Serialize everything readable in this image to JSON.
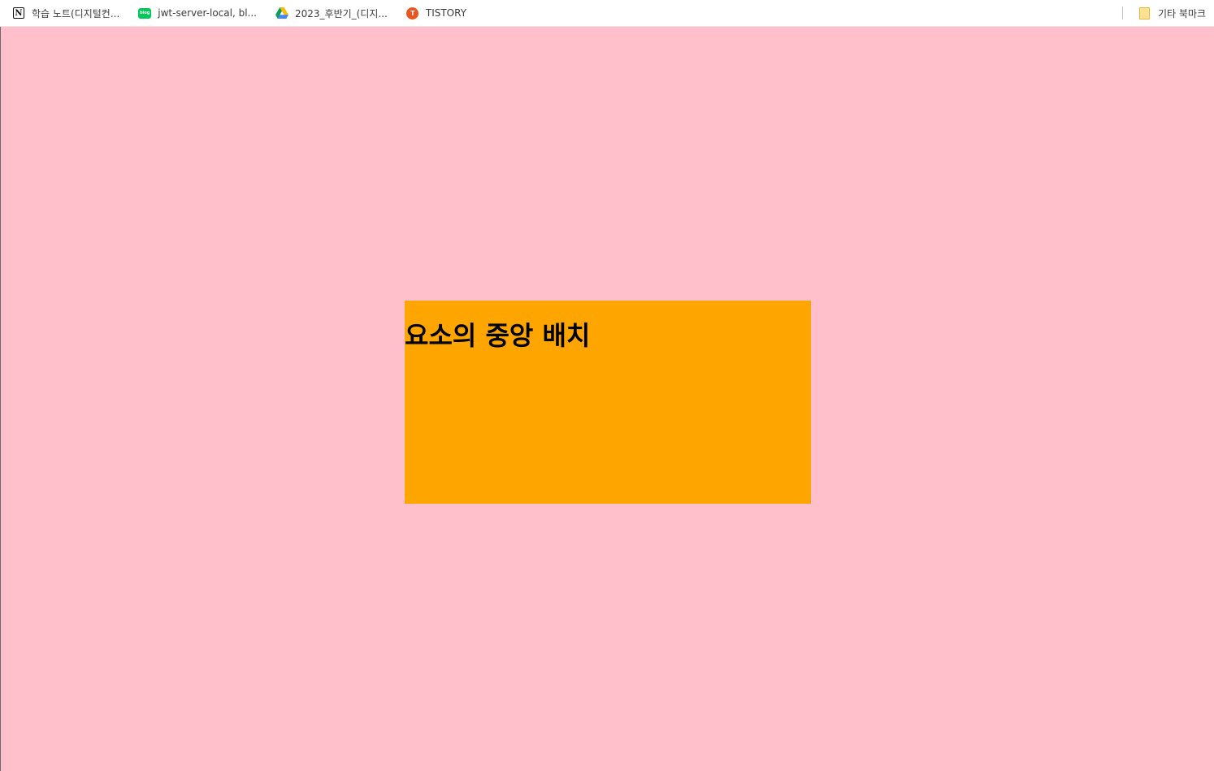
{
  "bookmarks_bar": {
    "items": [
      {
        "label": "학습 노트(디지털컨...",
        "icon": "notion-icon"
      },
      {
        "label": "jwt-server-local, bl...",
        "icon": "naver-blog-icon",
        "icon_text": "blog"
      },
      {
        "label": "2023_후반기_(디지...",
        "icon": "google-drive-icon"
      },
      {
        "label": "TISTORY",
        "icon": "tistory-icon",
        "icon_text": "T"
      }
    ],
    "other_bookmarks": {
      "label": "기타 북마크",
      "icon": "folder-icon"
    }
  },
  "page": {
    "background_color": "#ffc0cb",
    "box_color": "#ffa500",
    "heading": "요소의 중앙 배치"
  }
}
